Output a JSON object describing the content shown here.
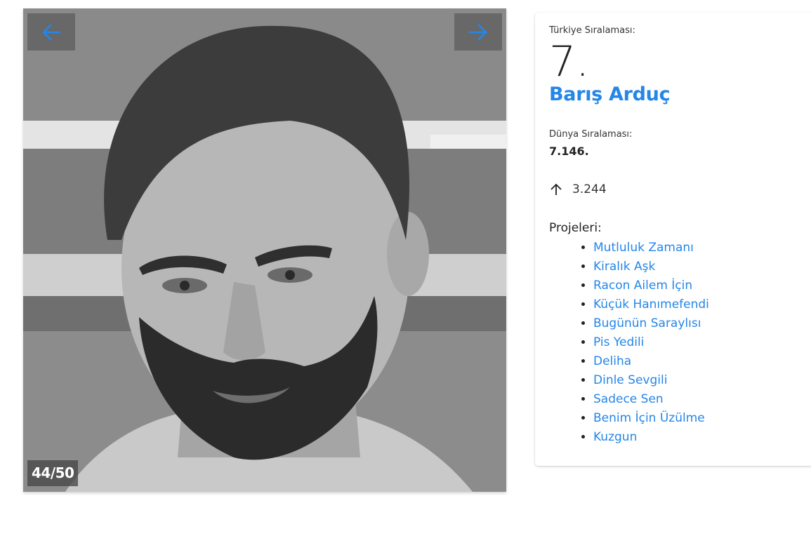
{
  "gallery": {
    "counter": "44/50",
    "prev_icon": "arrow-left-icon",
    "next_icon": "arrow-right-icon",
    "accent": "#2486e8"
  },
  "profile": {
    "turkey_rank_label": "Türkiye Sıralaması:",
    "turkey_rank": "7.",
    "name": "Barış Arduç",
    "world_rank_label": "Dünya Sıralaması:",
    "world_rank": "7.146.",
    "trend_icon": "arrow-up-icon",
    "trend_value": "3.244",
    "projects_label": "Projeleri:",
    "projects": [
      "Mutluluk Zamanı",
      "Kiralık Aşk",
      "Racon Ailem İçin",
      "Küçük Hanımefendi",
      "Bugünün Saraylısı",
      "Pis Yedili",
      "Deliha",
      "Dinle Sevgili",
      "Sadece Sen",
      "Benim İçin Üzülme",
      "Kuzgun"
    ]
  }
}
